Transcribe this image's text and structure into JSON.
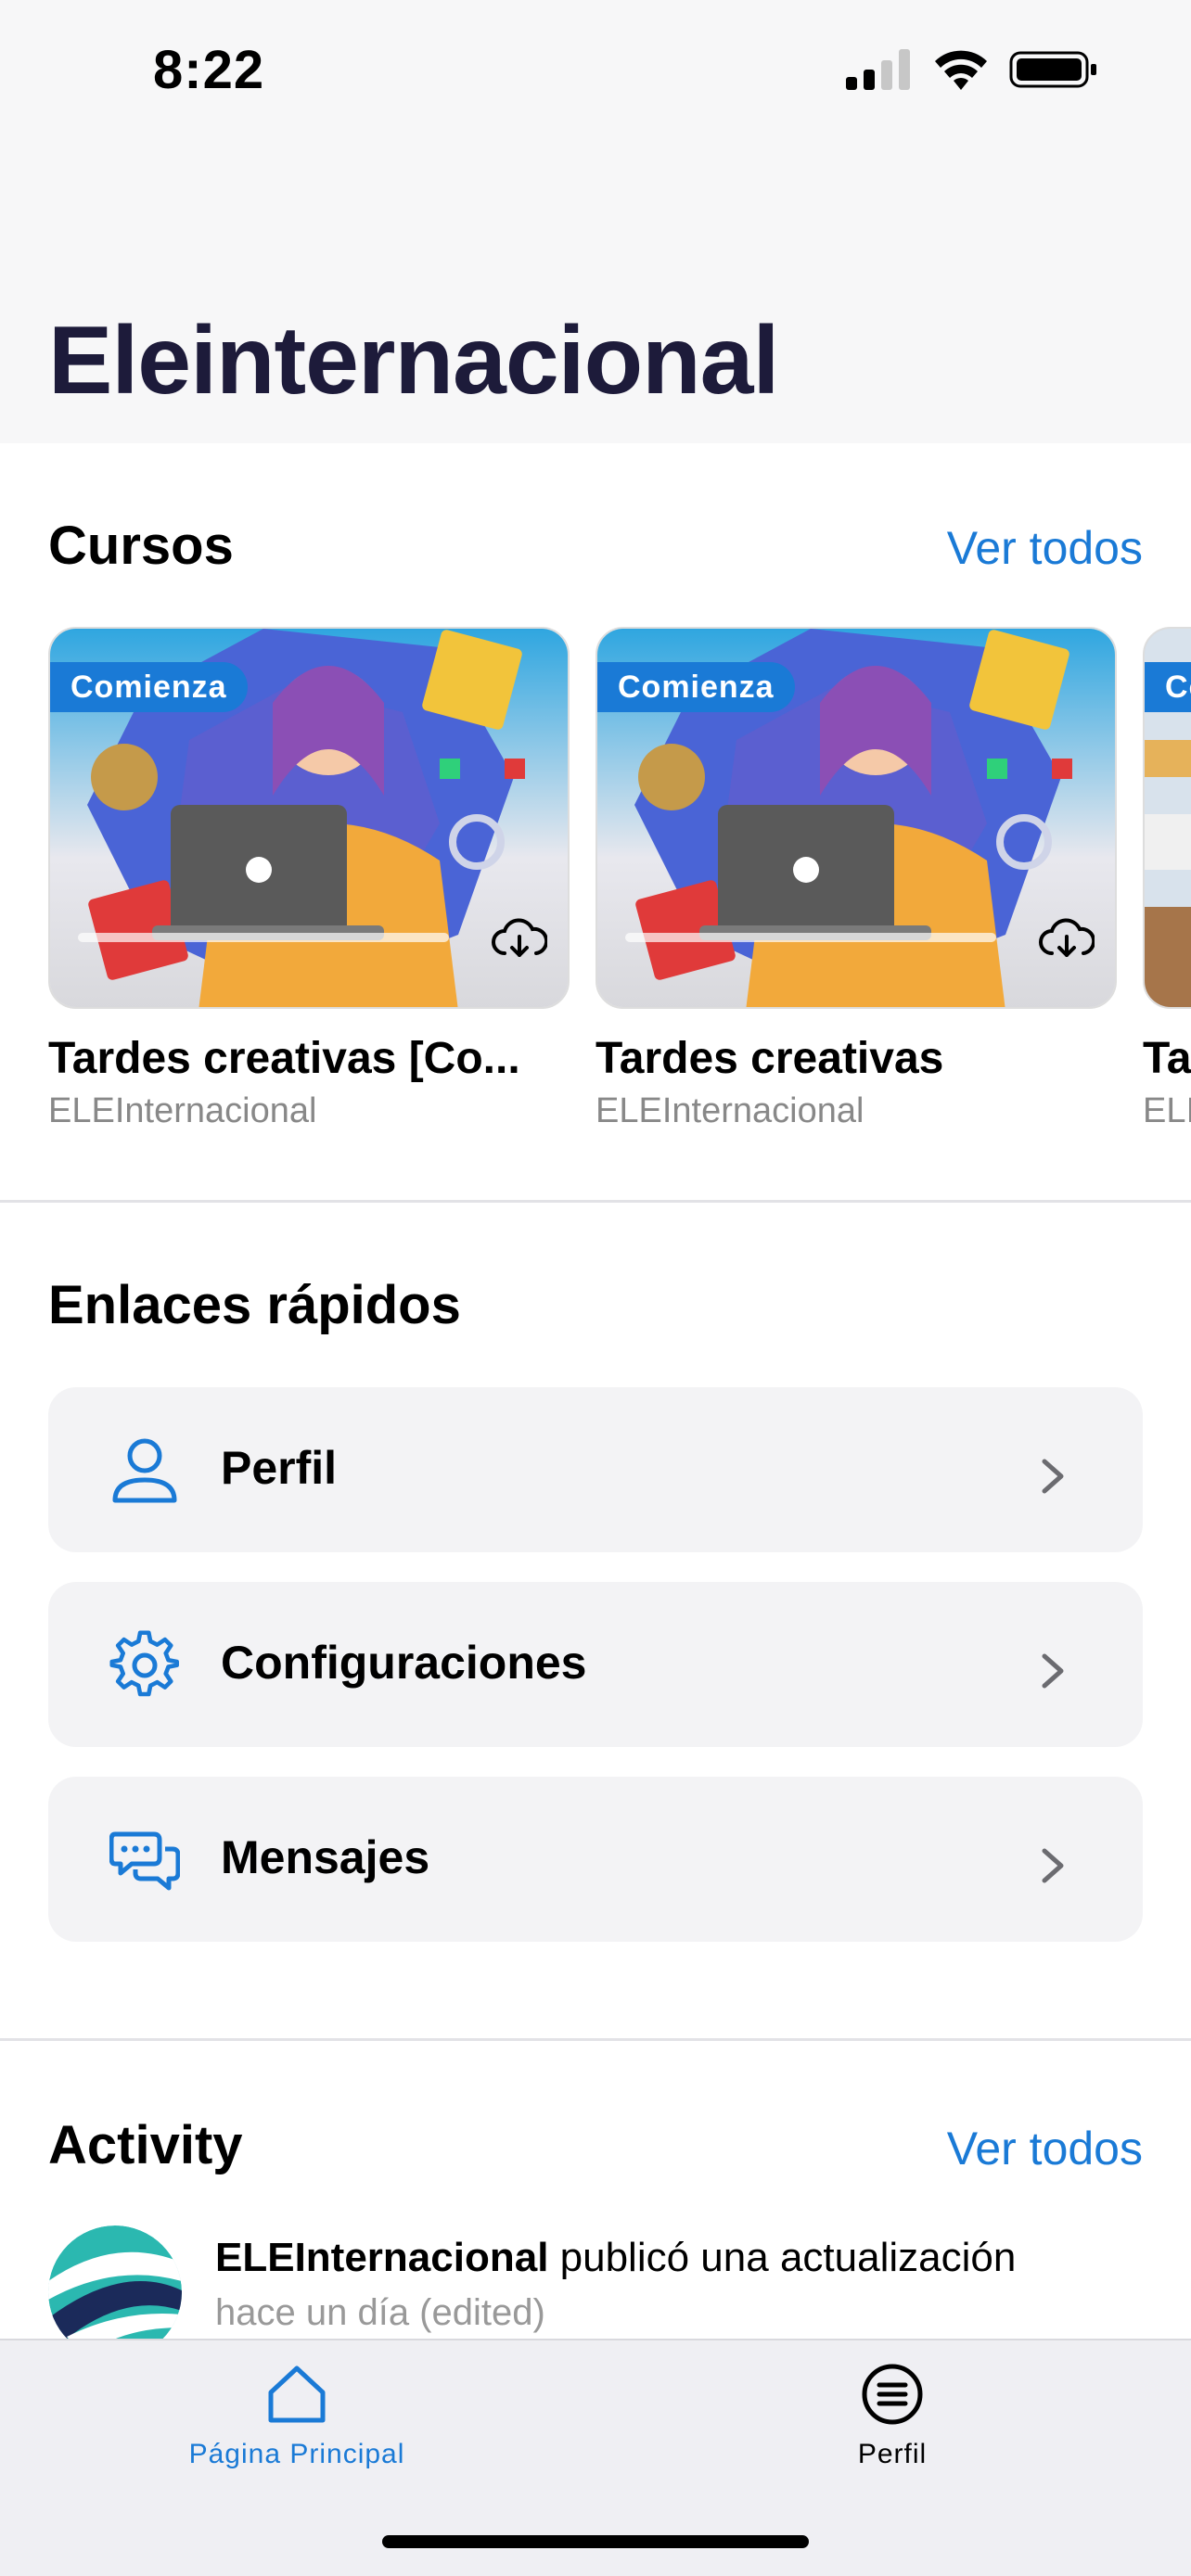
{
  "status_bar": {
    "time": "8:22"
  },
  "header": {
    "title": "Eleinternacional"
  },
  "courses_section": {
    "title": "Cursos",
    "see_all": "Ver todos",
    "items": [
      {
        "badge": "Comienza",
        "title": "Tardes creativas [Co...",
        "author": "ELEInternacional"
      },
      {
        "badge": "Comienza",
        "title": "Tardes creativas",
        "author": "ELEInternacional"
      },
      {
        "badge": "Co",
        "title": "Ta",
        "author": "ELI"
      }
    ]
  },
  "quick_links": {
    "title": "Enlaces rápidos",
    "items": [
      {
        "label": "Perfil",
        "icon": "person-icon"
      },
      {
        "label": "Configuraciones",
        "icon": "gear-icon"
      },
      {
        "label": "Mensajes",
        "icon": "chat-bubbles-icon"
      }
    ]
  },
  "activity": {
    "title": "Activity",
    "see_all": "Ver todos",
    "items": [
      {
        "actor": "ELEInternacional",
        "action": " publicó una actualización",
        "time": "hace un día (edited)"
      }
    ]
  },
  "tab_bar": {
    "tabs": [
      {
        "label": "Página Principal",
        "icon": "house-icon",
        "active": true
      },
      {
        "label": "Perfil",
        "icon": "list-circle-icon",
        "active": false
      }
    ]
  },
  "colors": {
    "accent": "#1a7ad6",
    "title": "#1d1b3a"
  }
}
